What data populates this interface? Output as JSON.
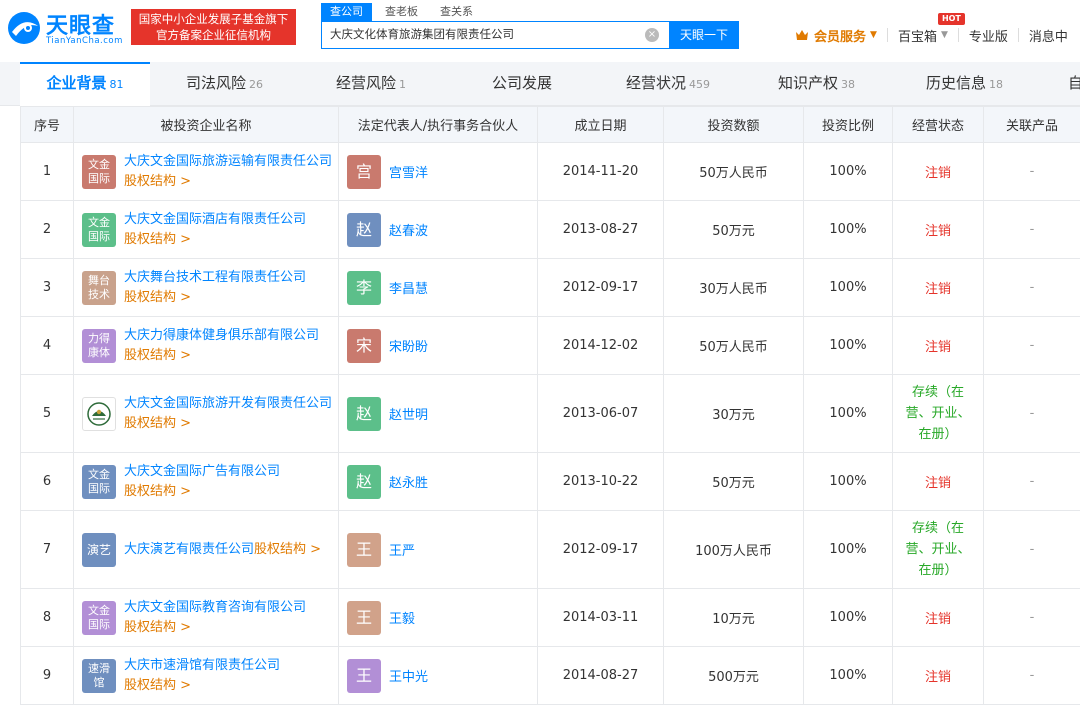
{
  "header": {
    "logo_text": "天眼查",
    "logo_domain": "TianYanCha.com",
    "slogan_line1": "国家中小企业发展子基金旗下",
    "slogan_line2": "官方备案企业征信机构",
    "search_tabs": [
      "查公司",
      "查老板",
      "查关系"
    ],
    "search_value": "大庆文化体育旅游集团有限责任公司",
    "search_button": "天眼一下",
    "vip_label": "会员服务",
    "baibao_label": "百宝箱",
    "hot_badge": "HOT",
    "pro_label": "专业版",
    "msg_label": "消息中"
  },
  "tabs": [
    {
      "label": "企业背景",
      "count": "81"
    },
    {
      "label": "司法风险",
      "count": "26"
    },
    {
      "label": "经营风险",
      "count": "1"
    },
    {
      "label": "公司发展",
      "count": ""
    },
    {
      "label": "经营状况",
      "count": "459"
    },
    {
      "label": "知识产权",
      "count": "38"
    },
    {
      "label": "历史信息",
      "count": "18"
    },
    {
      "label": "自",
      "count": ""
    }
  ],
  "table": {
    "headers": [
      "序号",
      "被投资企业名称",
      "法定代表人/执行事务合伙人",
      "成立日期",
      "投资数额",
      "投资比例",
      "经营状态",
      "关联产品"
    ],
    "equity_label": "股权结构 >",
    "rows": [
      {
        "no": "1",
        "logo_line1": "文金",
        "logo_line2": "国际",
        "logo_color": "#c97a6e",
        "name": "大庆文金国际旅游运输有限责任公司",
        "avatar_char": "宫",
        "avatar_color": "#c97a6e",
        "person": "宫雪洋",
        "date": "2014-11-20",
        "amount": "50万人民币",
        "ratio": "100%",
        "status": "注销",
        "product": "-"
      },
      {
        "no": "2",
        "logo_line1": "文金",
        "logo_line2": "国际",
        "logo_color": "#5cbf8a",
        "name": "大庆文金国际酒店有限责任公司",
        "avatar_char": "赵",
        "avatar_color": "#6f8fbf",
        "person": "赵春波",
        "date": "2013-08-27",
        "amount": "50万元",
        "ratio": "100%",
        "status": "注销",
        "product": "-"
      },
      {
        "no": "3",
        "logo_line1": "舞台",
        "logo_line2": "技术",
        "logo_color": "#c9a28c",
        "name": "大庆舞台技术工程有限责任公司",
        "avatar_char": "李",
        "avatar_color": "#5cbf8a",
        "person": "李昌慧",
        "date": "2012-09-17",
        "amount": "30万人民币",
        "ratio": "100%",
        "status": "注销",
        "product": "-"
      },
      {
        "no": "4",
        "logo_line1": "力得",
        "logo_line2": "康体",
        "logo_color": "#b28fd6",
        "name": "大庆力得康体健身俱乐部有限公司",
        "avatar_char": "宋",
        "avatar_color": "#c97a6e",
        "person": "宋盼盼",
        "date": "2014-12-02",
        "amount": "50万人民币",
        "ratio": "100%",
        "status": "注销",
        "product": "-"
      },
      {
        "no": "5",
        "logo_line1": "",
        "logo_line2": "",
        "logo_color": "emblem",
        "name": "大庆文金国际旅游开发有限责任公司",
        "avatar_char": "赵",
        "avatar_color": "#5cbf8a",
        "person": "赵世明",
        "date": "2013-06-07",
        "amount": "30万元",
        "ratio": "100%",
        "status": "存续（在营、开业、在册）",
        "product": "-"
      },
      {
        "no": "6",
        "logo_line1": "文金",
        "logo_line2": "国际",
        "logo_color": "#6f8fbf",
        "name": "大庆文金国际广告有限公司",
        "avatar_char": "赵",
        "avatar_color": "#5cbf8a",
        "person": "赵永胜",
        "date": "2013-10-22",
        "amount": "50万元",
        "ratio": "100%",
        "status": "注销",
        "product": "-"
      },
      {
        "no": "7",
        "logo_line1": "演艺",
        "logo_line2": "",
        "logo_color": "#6f8fbf",
        "name": "大庆演艺有限责任公司",
        "avatar_char": "王",
        "avatar_color": "#d1a28a",
        "person": "王严",
        "date": "2012-09-17",
        "amount": "100万人民币",
        "ratio": "100%",
        "status": "存续（在营、开业、在册）",
        "product": "-"
      },
      {
        "no": "8",
        "logo_line1": "文金",
        "logo_line2": "国际",
        "logo_color": "#b28fd6",
        "name": "大庆文金国际教育咨询有限公司",
        "avatar_char": "王",
        "avatar_color": "#d1a28a",
        "person": "王毅",
        "date": "2014-03-11",
        "amount": "10万元",
        "ratio": "100%",
        "status": "注销",
        "product": "-"
      },
      {
        "no": "9",
        "logo_line1": "速滑",
        "logo_line2": "馆",
        "logo_color": "#6f8fbf",
        "name": "大庆市速滑馆有限责任公司",
        "avatar_char": "王",
        "avatar_color": "#b28fd6",
        "person": "王中光",
        "date": "2014-08-27",
        "amount": "500万元",
        "ratio": "100%",
        "status": "注销",
        "product": "-"
      }
    ]
  },
  "colors": {
    "brand": "#0084ff",
    "danger": "#e5342b",
    "success": "#27a827",
    "accent": "#e07a00"
  }
}
